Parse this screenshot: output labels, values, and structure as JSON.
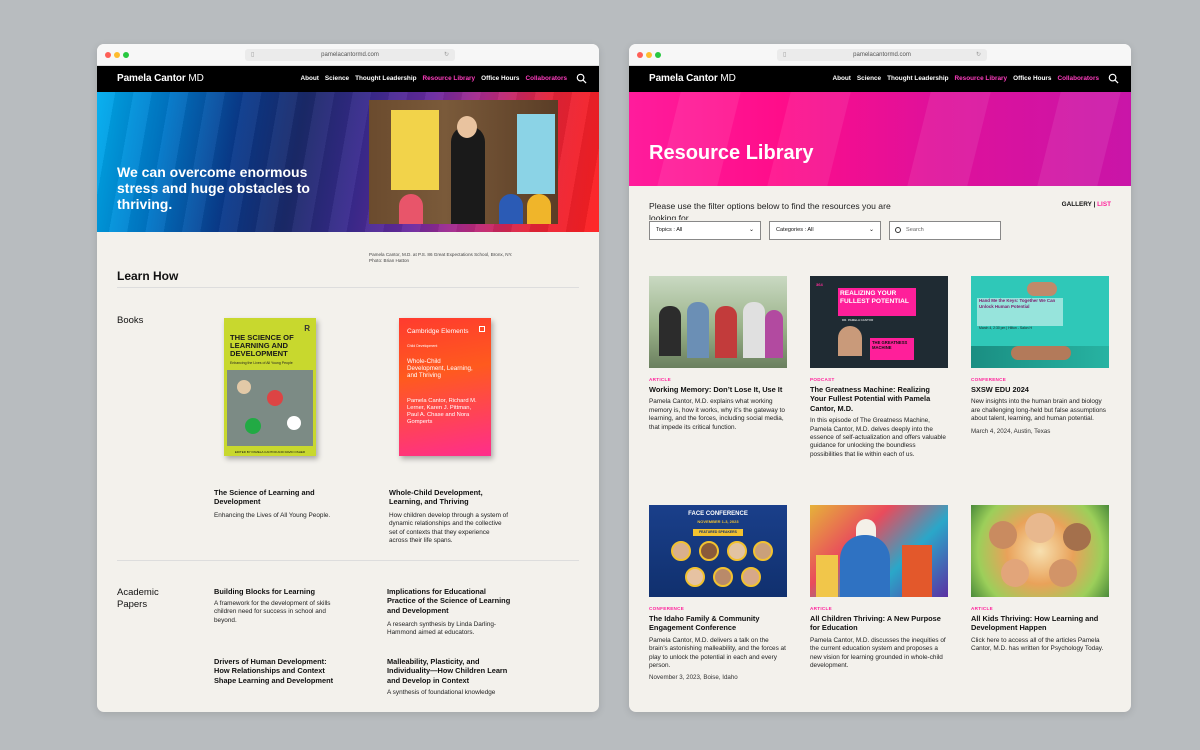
{
  "left": {
    "url": "pamelacantormd.com",
    "brand": {
      "name": "Pamela Cantor",
      "suffix": " MD"
    },
    "menu": [
      "About",
      "Science",
      "Thought Leadership",
      "Resource Library",
      "Office Hours",
      "Collaborators"
    ],
    "hero_heading": "We can overcome enormous stress and huge obstacles to thriving.",
    "photo_caption": "Pamela Cantor, M.D. at P.S. 86 Great Expectations School, Bronx, NY. Photo: Brian Hatton",
    "section_title": "Learn How",
    "books_label": "Books",
    "books": [
      {
        "cover_title": "THE SCIENCE OF LEARNING AND DEVELOPMENT",
        "cover_subtitle": "Enhancing the Lives of All Young People",
        "cover_footer": "EDITED BY PAMELA CANTOR AND DAVID OSHER",
        "title": "The Science of Learning and Development",
        "desc": "Enhancing the Lives of All Young People."
      },
      {
        "cover_series": "Cambridge Elements",
        "cover_series_sub": "Child Development",
        "cover_title": "Whole-Child Development, Learning, and Thriving",
        "cover_authors": "Pamela Cantor, Richard M. Lerner, Karen J. Pittman, Paul A. Chase and Nora Gomperts",
        "title": "Whole-Child Development, Learning, and Thriving",
        "desc": "How children develop through a system of dynamic relationships and the collective set of contexts that they experience across their life spans."
      }
    ],
    "papers_label": "Academic Papers",
    "papers": [
      {
        "title": "Building Blocks for Learning",
        "desc": "A framework for the development of skills children need for success in school and beyond."
      },
      {
        "title": "Implications for Educational Practice of the Science of Learning and Development",
        "desc": "A research synthesis by Linda Darling-Hammond aimed at educators."
      },
      {
        "title": "Drivers of Human Development: How Relationships and Context Shape Learning and Development",
        "desc": ""
      },
      {
        "title": "Malleability, Plasticity, and Individuality—How Children Learn and Develop in Context",
        "desc": "A synthesis of foundational knowledge"
      }
    ]
  },
  "right": {
    "url": "pamelacantormd.com",
    "brand": {
      "name": "Pamela Cantor",
      "suffix": " MD"
    },
    "menu": [
      "About",
      "Science",
      "Thought Leadership",
      "Resource Library",
      "Office Hours",
      "Collaborators"
    ],
    "hero_heading": "Resource Library",
    "intro": "Please use the filter options below to find the resources you are looking for.",
    "view_toggle": {
      "gallery": "GALLERY",
      "sep": " | ",
      "list": "LIST"
    },
    "filters": {
      "topics": "Topics : All",
      "categories": "Categories : All",
      "search_placeholder": "Search"
    },
    "thumb_texts": {
      "podcast_badge": "364",
      "podcast_title": "REALIZING YOUR FULLEST POTENTIAL",
      "podcast_guest": "DR. PAMELA CANTOR",
      "podcast_show": "THE GREATNESS MACHINE",
      "sxsw_line1": "Hand Me the Keys: Together We Can Unlock Human Potential",
      "sxsw_line2": "March 4, 2:30 pm | Hilton - Salon H",
      "face_title": "FACE CONFERENCE",
      "face_dates": "NOVEMBER 1-3, 2023",
      "face_speakers": "FEATURED SPEAKERS"
    },
    "cards": [
      {
        "tag": "ARTICLE",
        "title": "Working Memory: Don’t Lose It, Use It",
        "desc": "Pamela Cantor, M.D. explains what working memory is, how it works, why it’s the gateway to learning, and the forces, including social media, that impede its critical function.",
        "meta": ""
      },
      {
        "tag": "PODCAST",
        "title": "The Greatness Machine: Realizing Your Fullest Potential with Pamela Cantor, M.D.",
        "desc": "In this episode of The Greatness Machine, Pamela Cantor, M.D. delves deeply into the essence of self-actualization and offers valuable guidance for unlocking the boundless possibilities that lie within each of us.",
        "meta": ""
      },
      {
        "tag": "CONFERENCE",
        "title": "SXSW EDU 2024",
        "desc": "New insights into the human brain and biology are challenging long-held but false assumptions about talent, learning, and human potential.",
        "meta": "March 4, 2024, Austin, Texas"
      },
      {
        "tag": "CONFERENCE",
        "title": "The Idaho Family & Community Engagement Conference",
        "desc": "Pamela Cantor, M.D. delivers a talk on the brain’s astonishing malleability, and the forces at play to unlock the potential in each and every person.",
        "meta": "November 3, 2023, Boise, Idaho"
      },
      {
        "tag": "ARTICLE",
        "title": "All Children Thriving: A New Purpose for Education",
        "desc": "Pamela Cantor, M.D. discusses the inequities of the current education system and proposes a new vision for learning grounded in whole-child development.",
        "meta": ""
      },
      {
        "tag": "ARTICLE",
        "title": "All Kids Thriving: How Learning and Development Happen",
        "desc": "Click here to access all of the articles Pamela Cantor, M.D. has written for Psychology Today.",
        "meta": ""
      }
    ]
  },
  "colors": {
    "accent_pink": "#ff1f9a",
    "nav_bg": "#000000",
    "page_bg": "#f3f1ec"
  }
}
